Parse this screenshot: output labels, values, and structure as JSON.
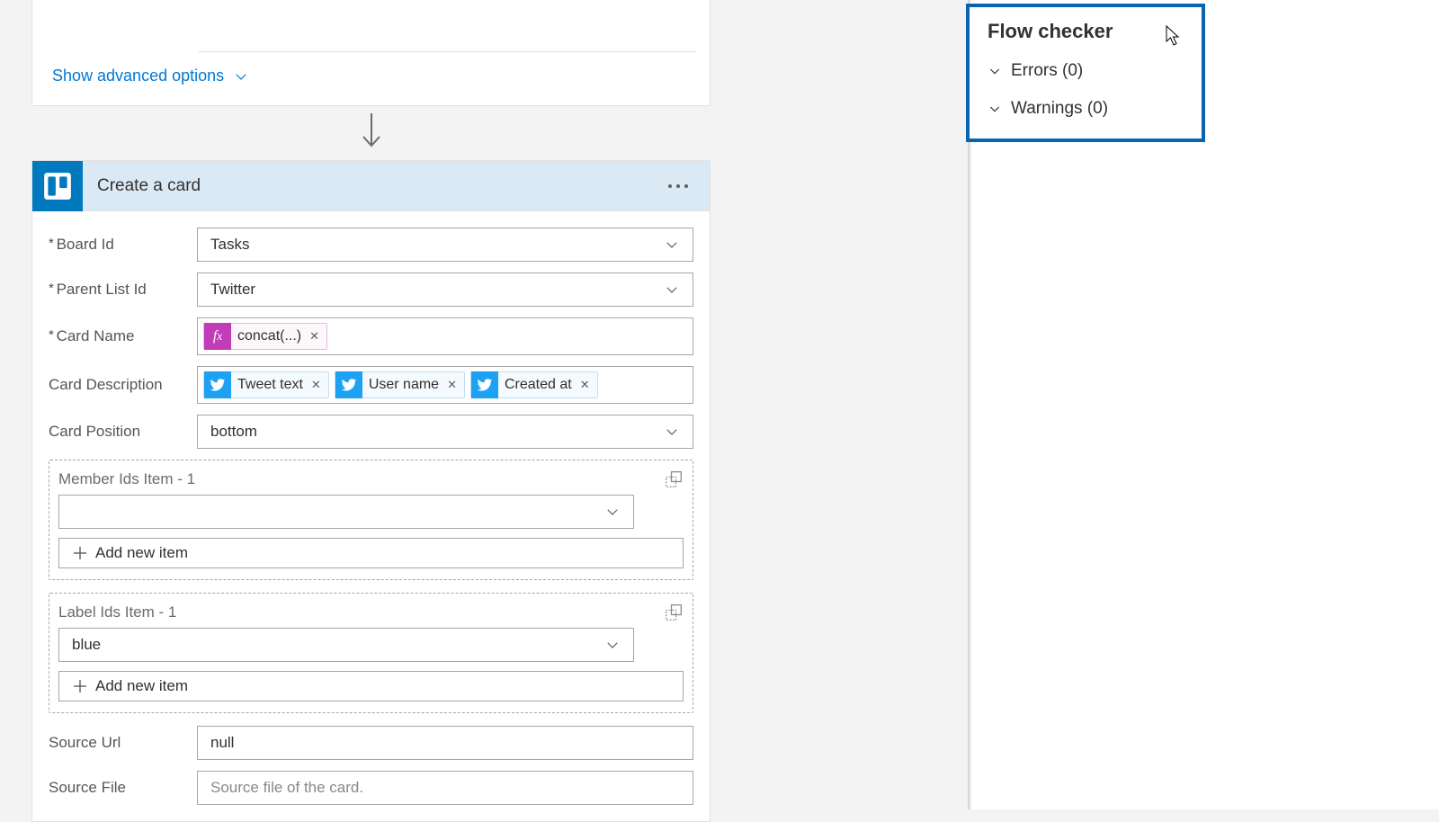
{
  "top": {
    "advanced": "Show advanced options"
  },
  "action": {
    "title": "Create a card",
    "boardId": {
      "label": "Board Id",
      "value": "Tasks"
    },
    "parentListId": {
      "label": "Parent List Id",
      "value": "Twitter"
    },
    "cardName": {
      "label": "Card Name",
      "tokens": [
        {
          "type": "fx",
          "text": "concat(...)"
        }
      ]
    },
    "cardDescription": {
      "label": "Card Description",
      "tokens": [
        {
          "type": "twitter",
          "text": "Tweet text"
        },
        {
          "type": "twitter",
          "text": "User name"
        },
        {
          "type": "twitter",
          "text": "Created at"
        }
      ]
    },
    "cardPosition": {
      "label": "Card Position",
      "value": "bottom"
    },
    "memberIds": {
      "label": "Member Ids Item - 1",
      "addLabel": "Add new item",
      "value": ""
    },
    "labelIds": {
      "label": "Label Ids Item - 1",
      "addLabel": "Add new item",
      "value": "blue"
    },
    "sourceUrl": {
      "label": "Source Url",
      "value": "null"
    },
    "sourceFile": {
      "label": "Source File",
      "placeholder": "Source file of the card."
    }
  },
  "checker": {
    "title": "Flow checker",
    "errors": "Errors (0)",
    "warnings": "Warnings (0)"
  }
}
